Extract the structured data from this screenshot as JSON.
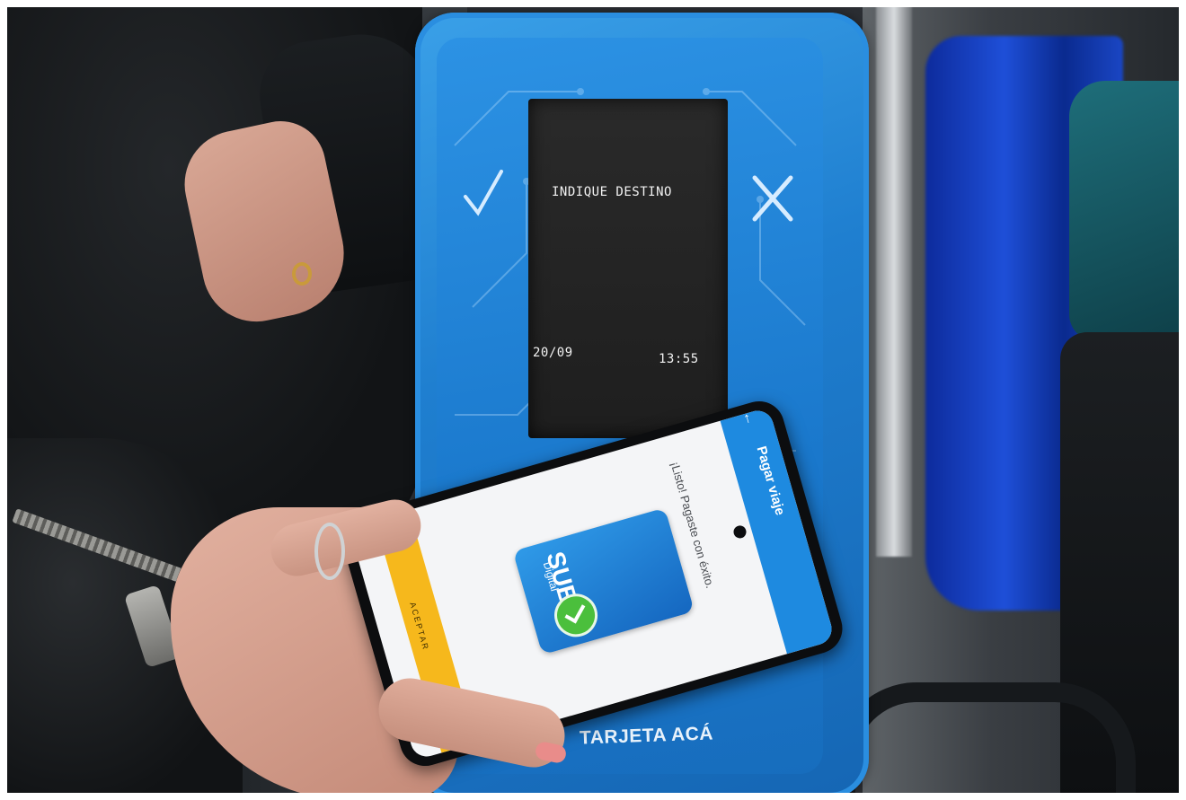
{
  "validator": {
    "screen_prompt": "INDIQUE  DESTINO",
    "screen_date": "20/09",
    "screen_time": "13:55",
    "bottom_label": "TARJETA ACÁ",
    "body_color": "#1f7fd0"
  },
  "phone_app": {
    "header_title": "Pagar viaje",
    "message": "¡Listo! Pagaste con éxito.",
    "card_brand": "SUBE",
    "card_subtitle": "Digital",
    "accept_label": "ACEPTAR",
    "accent_color": "#1e8ae0"
  },
  "scene": {
    "icons": [
      "check-icon",
      "cross-icon",
      "success-check-icon"
    ]
  }
}
